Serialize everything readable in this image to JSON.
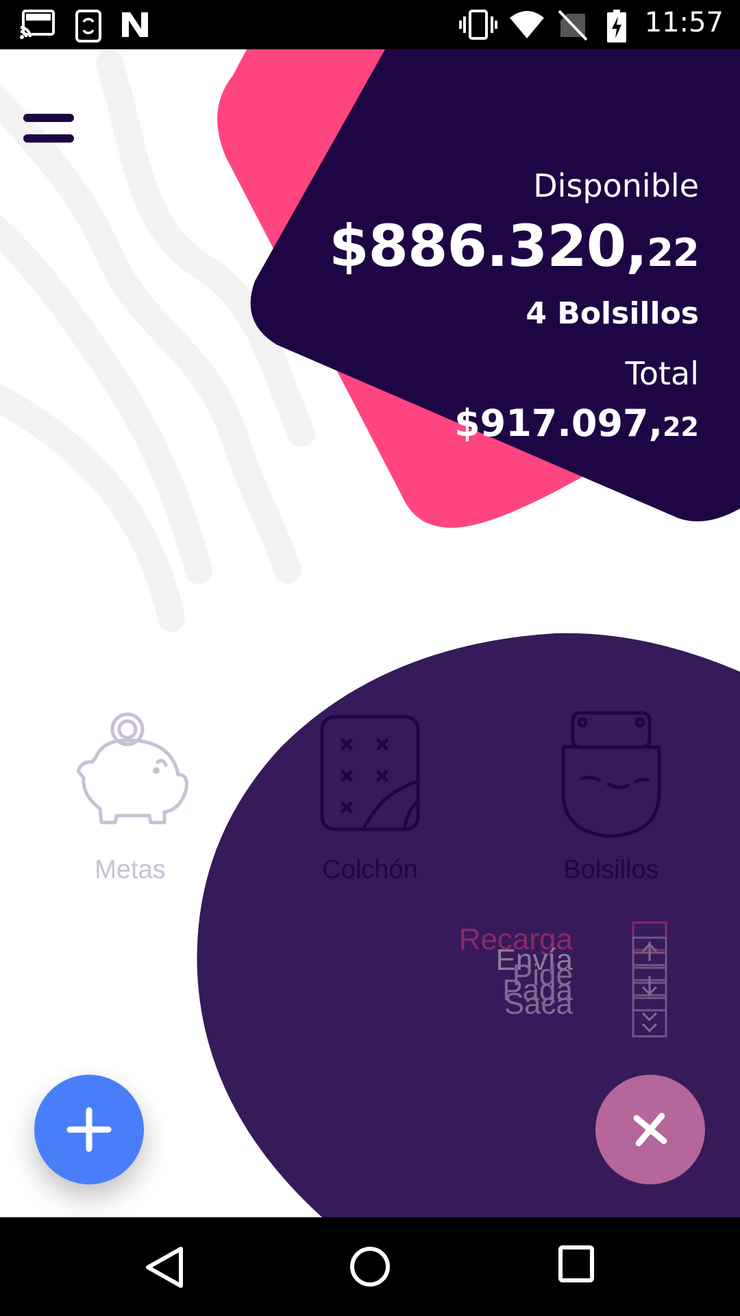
{
  "status_bar": {
    "time": "11:57",
    "icons": [
      "cast-icon",
      "sync-phone-icon",
      "n-logo-icon",
      "vibrate-icon",
      "wifi-icon",
      "no-sim-icon",
      "battery-charging-icon"
    ]
  },
  "summary": {
    "available_label": "Disponible",
    "available_amount_main": "$886.320,",
    "available_amount_cents": "22",
    "pockets_count": "4 Bolsillos",
    "total_label": "Total",
    "total_amount_main": "$917.097,",
    "total_amount_cents": "22"
  },
  "categories": [
    {
      "label": "Metas",
      "icon": "piggy-bank-icon"
    },
    {
      "label": "Colchón",
      "icon": "mattress-icon"
    },
    {
      "label": "Bolsillos",
      "icon": "pocket-icon"
    }
  ],
  "actions": [
    {
      "label": "Recarga"
    },
    {
      "label": "Envía"
    },
    {
      "label": "Pide"
    },
    {
      "label": "Paga"
    },
    {
      "label": "Saca"
    }
  ],
  "nav_bar": {
    "icons": [
      "back-icon",
      "home-icon",
      "recents-icon"
    ]
  },
  "colors": {
    "primary_dark": "#1e0645",
    "card_pink": "#ff4580",
    "overlay_purple": "#371a5a",
    "fab_blue": "#4a7ef9",
    "fab_pink": "#b5669a"
  }
}
